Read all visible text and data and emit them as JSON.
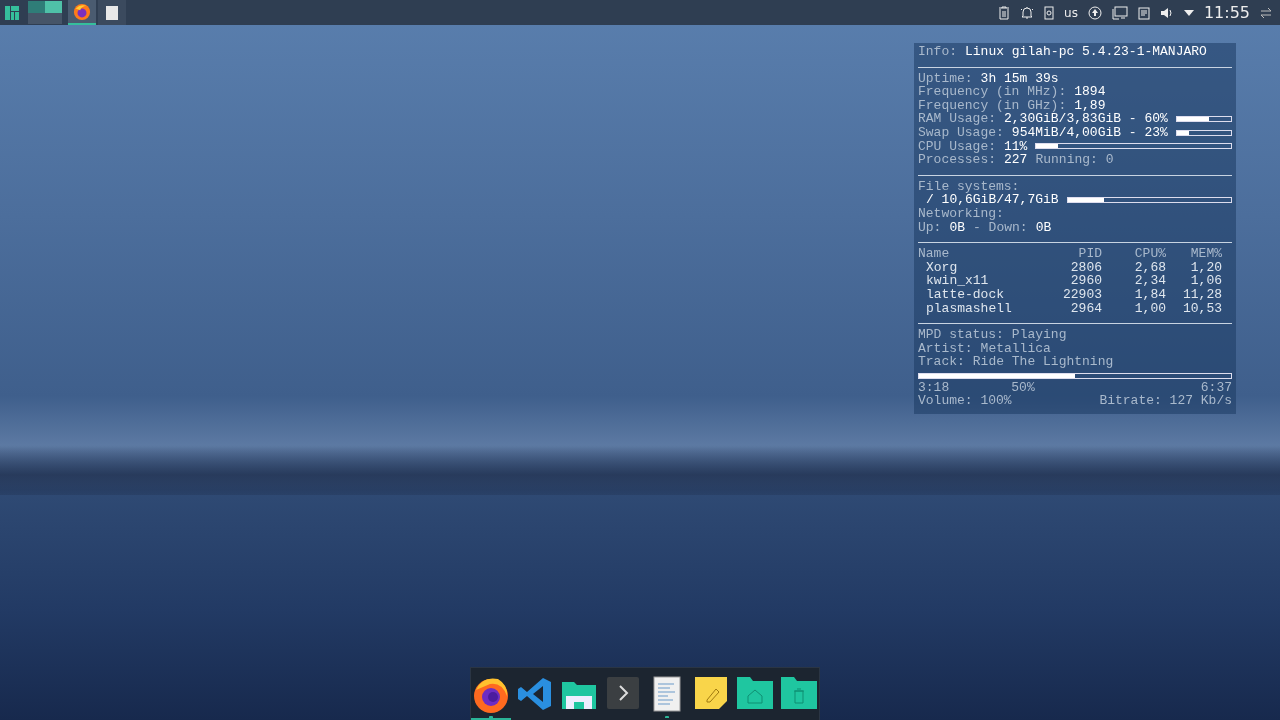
{
  "top_panel": {
    "tasks": [
      {
        "kind": "browser",
        "selected": true
      },
      {
        "kind": "document",
        "selected": false
      }
    ],
    "tray": {
      "keyboard_layout": "us",
      "clock": "11:55"
    }
  },
  "conky": {
    "info": [
      {
        "text": "Info:",
        "bright": false
      },
      {
        "text": "Linux gilah-pc 5.4.23-1-MANJARO",
        "bright": true
      }
    ],
    "system": [
      {
        "parts": [
          {
            "text": "Uptime:",
            "bright": false
          },
          {
            "text": "3h 15m 39s",
            "bright": true
          }
        ]
      },
      {
        "parts": [
          {
            "text": "Frequency (in MHz):",
            "bright": false
          },
          {
            "text": "1894",
            "bright": true
          }
        ]
      },
      {
        "parts": [
          {
            "text": "Frequency (in GHz):",
            "bright": false
          },
          {
            "text": "1,89",
            "bright": true
          }
        ]
      },
      {
        "parts": [
          {
            "text": "RAM Usage:",
            "bright": false
          },
          {
            "text": "2,30GiB/3,83GiB - 60%",
            "bright": true
          }
        ],
        "level": 0.6
      },
      {
        "parts": [
          {
            "text": "Swap Usage:",
            "bright": false
          },
          {
            "text": "954MiB/4,00GiB - 23%",
            "bright": true
          }
        ],
        "level": 0.23
      },
      {
        "parts": [
          {
            "text": "CPU Usage:",
            "bright": false
          },
          {
            "text": "11%",
            "bright": true
          }
        ],
        "level": 0.11
      },
      {
        "parts": [
          {
            "text": "Processes:",
            "bright": false
          },
          {
            "text": "227",
            "bright": true
          },
          {
            "text": "Running: 0",
            "bright": false
          }
        ]
      }
    ],
    "storage": [
      {
        "parts": [
          {
            "text": "File systems:",
            "bright": false
          }
        ]
      },
      {
        "parts": [
          {
            "text": "/ 10,6GiB/47,7GiB",
            "bright": true
          }
        ],
        "level": 0.22
      },
      {
        "parts": [
          {
            "text": "Networking:",
            "bright": false
          }
        ]
      },
      {
        "parts": [
          {
            "text": "Up:",
            "bright": false
          },
          {
            "text": "0B",
            "bright": true
          },
          {
            "text": "- Down:",
            "bright": false
          },
          {
            "text": "0B",
            "bright": true
          }
        ]
      }
    ],
    "processes": {
      "columns": [
        "Name",
        "PID",
        "CPU%",
        "MEM%"
      ],
      "rows": [
        [
          "Xorg",
          "2806",
          "2,68",
          "1,20"
        ],
        [
          "kwin_x11",
          "2960",
          "2,34",
          "1,06"
        ],
        [
          "latte-dock",
          "22903",
          "1,84",
          "11,28"
        ],
        [
          "plasmashell",
          "2964",
          "1,00",
          "10,53"
        ]
      ]
    },
    "mpd": {
      "lines": [
        {
          "label": "MPD status:",
          "value": "Playing"
        },
        {
          "label": "Artist:",
          "value": "Metallica"
        },
        {
          "label": "Track:",
          "value": "Ride The Lightning"
        }
      ],
      "level": 0.5,
      "elapsed": "3:18",
      "percent": "50%",
      "total": "6:37",
      "volume": "Volume: 100%",
      "bitrate": "Bitrate: 127 Kb/s"
    }
  },
  "dock": [
    {
      "kind": "firefox",
      "active": true,
      "running": true
    },
    {
      "kind": "code",
      "active": false,
      "running": false
    },
    {
      "kind": "files",
      "active": false,
      "running": false
    },
    {
      "kind": "terminal",
      "active": false,
      "running": false
    },
    {
      "kind": "editor",
      "active": false,
      "running": true
    },
    {
      "kind": "notes",
      "active": false,
      "running": false
    },
    {
      "kind": "home",
      "active": false,
      "running": false
    },
    {
      "kind": "trash",
      "active": false,
      "running": false
    }
  ]
}
